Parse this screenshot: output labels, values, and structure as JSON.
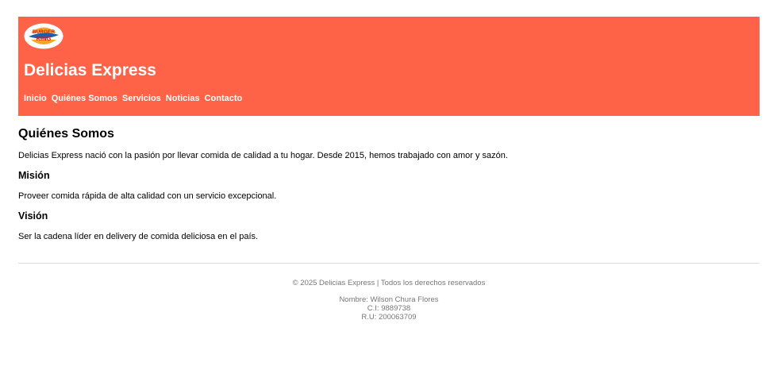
{
  "header": {
    "logo": {
      "icon": "burger-king-logo",
      "text_top": "BURGER",
      "text_bottom": "KING"
    },
    "site_title": "Delicias Express",
    "nav": [
      {
        "label": "Inicio"
      },
      {
        "label": "Quiénes Somos"
      },
      {
        "label": "Servicios"
      },
      {
        "label": "Noticias"
      },
      {
        "label": "Contacto"
      }
    ]
  },
  "main": {
    "title": "Quiénes Somos",
    "intro": "Delicias Express nació con la pasión por llevar comida de calidad a tu hogar. Desde 2015, hemos trabajado con amor y sazón.",
    "mission_heading": "Misión",
    "mission_text": "Proveer comida rápida de alta calidad con un servicio excepcional.",
    "vision_heading": "Visión",
    "vision_text": "Ser la cadena líder en delivery de comida deliciosa en el país."
  },
  "footer": {
    "copyright": "© 2025 Delicias Express | Todos los derechos reservados",
    "name": "Nombre: Wilson Chura Flores",
    "ci": "C.I: 9889738",
    "ru": "R.U: 200063709"
  },
  "colors": {
    "header_bg": "#ff6347",
    "header_text": "#ffffff",
    "footer_text": "#777777",
    "divider": "#dddddd"
  }
}
